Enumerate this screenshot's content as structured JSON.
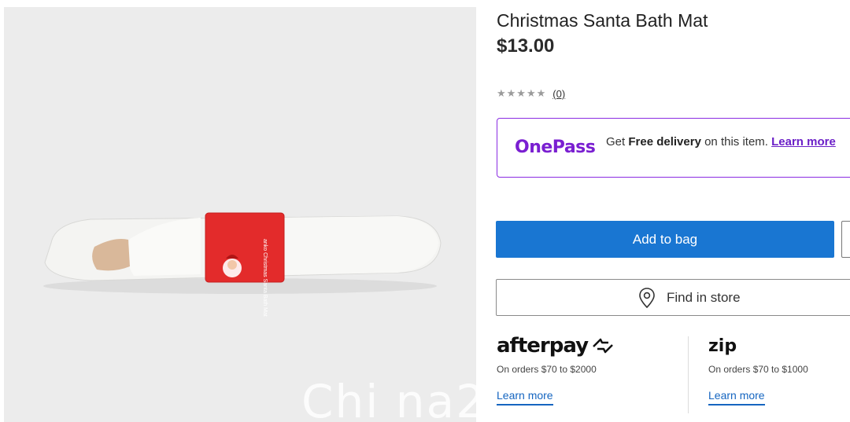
{
  "product": {
    "title": "Christmas Santa Bath Mat",
    "price": "$13.00",
    "rating_count": "(0)",
    "rating_value": 0,
    "rating_max": 5
  },
  "onepass": {
    "logo": "OnePass",
    "text_prefix": "Get ",
    "text_bold": "Free delivery",
    "text_suffix": " on this item. ",
    "link": "Learn more"
  },
  "actions": {
    "add_to_bag": "Add to bag",
    "find_in_store": "Find in store"
  },
  "payments": {
    "afterpay": {
      "logo": "afterpay",
      "note": "On orders $70 to $2000",
      "link": "Learn more"
    },
    "zip": {
      "logo": "zip",
      "note": "On orders $70 to $1000",
      "link": "Learn more"
    }
  },
  "product_image": {
    "band_text": "anko Christmas Santa Bath Mat"
  },
  "watermark": "Chi na2",
  "colors": {
    "primary_button": "#1976d2",
    "onepass_purple": "#7a1fd1",
    "link_blue": "#1565c0",
    "band_red": "#e32b2b"
  }
}
